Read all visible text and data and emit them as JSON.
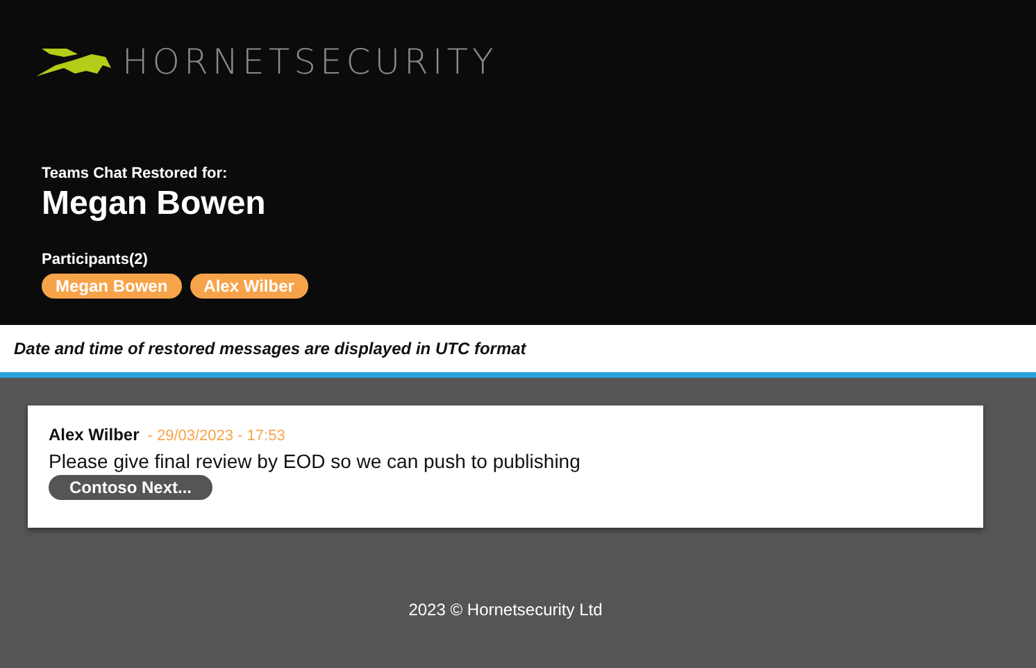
{
  "logo": {
    "text": "HORNETSECURITY"
  },
  "header": {
    "subtitle": "Teams Chat Restored for:",
    "title": "Megan Bowen",
    "participants_label": "Participants(2)",
    "participants": [
      "Megan Bowen",
      "Alex Wilber"
    ]
  },
  "notice": "Date and time of restored messages are displayed in UTC format",
  "messages": [
    {
      "author": "Alex Wilber",
      "timestamp": "- 29/03/2023 - 17:53",
      "text": "Please give final review by EOD so we can push to publishing",
      "attachment": "Contoso Next..."
    }
  ],
  "footer": "2023 © Hornetsecurity Ltd"
}
